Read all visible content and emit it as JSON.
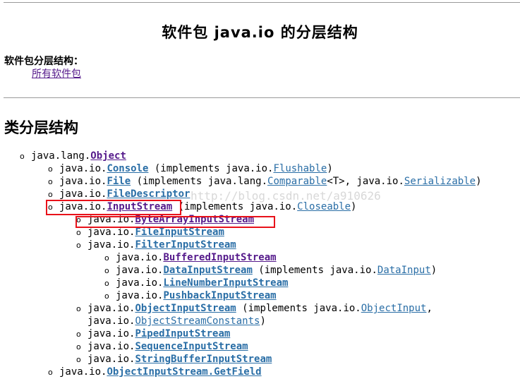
{
  "page": {
    "title": "软件包 java.io 的分层结构",
    "package_hierarchy_label": "软件包分层结构：",
    "all_packages_link": "所有软件包",
    "section_heading": "类分层结构",
    "watermark": "http://blog.csdn.net/a910626"
  },
  "tree": [
    {
      "indent": 0,
      "prefix": "java.lang.",
      "name": "Object",
      "visited": true,
      "rest": []
    },
    {
      "indent": 1,
      "prefix": "java.io.",
      "name": "Console",
      "visited": false,
      "rest": [
        {
          "t": " (implements java.io."
        },
        {
          "l": "Flushable"
        },
        {
          "t": ")"
        }
      ]
    },
    {
      "indent": 1,
      "prefix": "java.io.",
      "name": "File",
      "visited": false,
      "rest": [
        {
          "t": " (implements java.lang."
        },
        {
          "l": "Comparable"
        },
        {
          "t": "<T>, java.io."
        },
        {
          "l": "Serializable"
        },
        {
          "t": ")"
        }
      ]
    },
    {
      "indent": 1,
      "prefix": "java.io.",
      "name": "FileDescriptor",
      "visited": false,
      "rest": []
    },
    {
      "indent": 1,
      "prefix": "java.io.",
      "name": "InputStream",
      "visited": true,
      "rest": [
        {
          "t": " (implements java.io."
        },
        {
          "l": "Closeable"
        },
        {
          "t": ")"
        }
      ]
    },
    {
      "indent": 2,
      "prefix": "java.io.",
      "name": "ByteArrayInputStream",
      "visited": true,
      "rest": []
    },
    {
      "indent": 2,
      "prefix": "java.io.",
      "name": "FileInputStream",
      "visited": false,
      "rest": []
    },
    {
      "indent": 2,
      "prefix": "java.io.",
      "name": "FilterInputStream",
      "visited": false,
      "rest": []
    },
    {
      "indent": 3,
      "prefix": "java.io.",
      "name": "BufferedInputStream",
      "visited": true,
      "rest": []
    },
    {
      "indent": 3,
      "prefix": "java.io.",
      "name": "DataInputStream",
      "visited": false,
      "rest": [
        {
          "t": " (implements java.io."
        },
        {
          "l": "DataInput"
        },
        {
          "t": ")"
        }
      ]
    },
    {
      "indent": 3,
      "prefix": "java.io.",
      "name": "LineNumberInputStream",
      "visited": false,
      "rest": []
    },
    {
      "indent": 3,
      "prefix": "java.io.",
      "name": "PushbackInputStream",
      "visited": false,
      "rest": []
    },
    {
      "indent": 2,
      "prefix": "java.io.",
      "name": "ObjectInputStream",
      "visited": false,
      "rest": [
        {
          "t": " (implements java.io."
        },
        {
          "l": "ObjectInput"
        },
        {
          "t": ","
        }
      ]
    },
    {
      "indent": 2,
      "cont": true,
      "prefix": "java.io.",
      "name": "ObjectStreamConstants",
      "plain": true,
      "visited": false,
      "rest": [
        {
          "t": ")"
        }
      ]
    },
    {
      "indent": 2,
      "prefix": "java.io.",
      "name": "PipedInputStream",
      "visited": false,
      "rest": []
    },
    {
      "indent": 2,
      "prefix": "java.io.",
      "name": "SequenceInputStream",
      "visited": false,
      "rest": []
    },
    {
      "indent": 2,
      "prefix": "java.io.",
      "name": "StringBufferInputStream",
      "visited": false,
      "rest": []
    },
    {
      "indent": 1,
      "prefix": "java.io.",
      "name": "ObjectInputStream.GetField",
      "visited": false,
      "rest": []
    }
  ]
}
